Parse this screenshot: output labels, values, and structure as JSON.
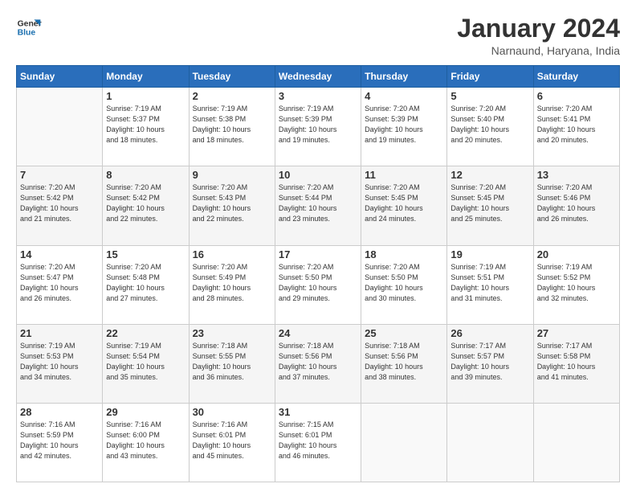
{
  "header": {
    "logo_line1": "General",
    "logo_line2": "Blue",
    "title": "January 2024",
    "location": "Narnaund, Haryana, India"
  },
  "weekdays": [
    "Sunday",
    "Monday",
    "Tuesday",
    "Wednesday",
    "Thursday",
    "Friday",
    "Saturday"
  ],
  "weeks": [
    [
      {
        "day": "",
        "info": ""
      },
      {
        "day": "1",
        "info": "Sunrise: 7:19 AM\nSunset: 5:37 PM\nDaylight: 10 hours\nand 18 minutes."
      },
      {
        "day": "2",
        "info": "Sunrise: 7:19 AM\nSunset: 5:38 PM\nDaylight: 10 hours\nand 18 minutes."
      },
      {
        "day": "3",
        "info": "Sunrise: 7:19 AM\nSunset: 5:39 PM\nDaylight: 10 hours\nand 19 minutes."
      },
      {
        "day": "4",
        "info": "Sunrise: 7:20 AM\nSunset: 5:39 PM\nDaylight: 10 hours\nand 19 minutes."
      },
      {
        "day": "5",
        "info": "Sunrise: 7:20 AM\nSunset: 5:40 PM\nDaylight: 10 hours\nand 20 minutes."
      },
      {
        "day": "6",
        "info": "Sunrise: 7:20 AM\nSunset: 5:41 PM\nDaylight: 10 hours\nand 20 minutes."
      }
    ],
    [
      {
        "day": "7",
        "info": "Sunrise: 7:20 AM\nSunset: 5:42 PM\nDaylight: 10 hours\nand 21 minutes."
      },
      {
        "day": "8",
        "info": "Sunrise: 7:20 AM\nSunset: 5:42 PM\nDaylight: 10 hours\nand 22 minutes."
      },
      {
        "day": "9",
        "info": "Sunrise: 7:20 AM\nSunset: 5:43 PM\nDaylight: 10 hours\nand 22 minutes."
      },
      {
        "day": "10",
        "info": "Sunrise: 7:20 AM\nSunset: 5:44 PM\nDaylight: 10 hours\nand 23 minutes."
      },
      {
        "day": "11",
        "info": "Sunrise: 7:20 AM\nSunset: 5:45 PM\nDaylight: 10 hours\nand 24 minutes."
      },
      {
        "day": "12",
        "info": "Sunrise: 7:20 AM\nSunset: 5:45 PM\nDaylight: 10 hours\nand 25 minutes."
      },
      {
        "day": "13",
        "info": "Sunrise: 7:20 AM\nSunset: 5:46 PM\nDaylight: 10 hours\nand 26 minutes."
      }
    ],
    [
      {
        "day": "14",
        "info": "Sunrise: 7:20 AM\nSunset: 5:47 PM\nDaylight: 10 hours\nand 26 minutes."
      },
      {
        "day": "15",
        "info": "Sunrise: 7:20 AM\nSunset: 5:48 PM\nDaylight: 10 hours\nand 27 minutes."
      },
      {
        "day": "16",
        "info": "Sunrise: 7:20 AM\nSunset: 5:49 PM\nDaylight: 10 hours\nand 28 minutes."
      },
      {
        "day": "17",
        "info": "Sunrise: 7:20 AM\nSunset: 5:50 PM\nDaylight: 10 hours\nand 29 minutes."
      },
      {
        "day": "18",
        "info": "Sunrise: 7:20 AM\nSunset: 5:50 PM\nDaylight: 10 hours\nand 30 minutes."
      },
      {
        "day": "19",
        "info": "Sunrise: 7:19 AM\nSunset: 5:51 PM\nDaylight: 10 hours\nand 31 minutes."
      },
      {
        "day": "20",
        "info": "Sunrise: 7:19 AM\nSunset: 5:52 PM\nDaylight: 10 hours\nand 32 minutes."
      }
    ],
    [
      {
        "day": "21",
        "info": "Sunrise: 7:19 AM\nSunset: 5:53 PM\nDaylight: 10 hours\nand 34 minutes."
      },
      {
        "day": "22",
        "info": "Sunrise: 7:19 AM\nSunset: 5:54 PM\nDaylight: 10 hours\nand 35 minutes."
      },
      {
        "day": "23",
        "info": "Sunrise: 7:18 AM\nSunset: 5:55 PM\nDaylight: 10 hours\nand 36 minutes."
      },
      {
        "day": "24",
        "info": "Sunrise: 7:18 AM\nSunset: 5:56 PM\nDaylight: 10 hours\nand 37 minutes."
      },
      {
        "day": "25",
        "info": "Sunrise: 7:18 AM\nSunset: 5:56 PM\nDaylight: 10 hours\nand 38 minutes."
      },
      {
        "day": "26",
        "info": "Sunrise: 7:17 AM\nSunset: 5:57 PM\nDaylight: 10 hours\nand 39 minutes."
      },
      {
        "day": "27",
        "info": "Sunrise: 7:17 AM\nSunset: 5:58 PM\nDaylight: 10 hours\nand 41 minutes."
      }
    ],
    [
      {
        "day": "28",
        "info": "Sunrise: 7:16 AM\nSunset: 5:59 PM\nDaylight: 10 hours\nand 42 minutes."
      },
      {
        "day": "29",
        "info": "Sunrise: 7:16 AM\nSunset: 6:00 PM\nDaylight: 10 hours\nand 43 minutes."
      },
      {
        "day": "30",
        "info": "Sunrise: 7:16 AM\nSunset: 6:01 PM\nDaylight: 10 hours\nand 45 minutes."
      },
      {
        "day": "31",
        "info": "Sunrise: 7:15 AM\nSunset: 6:01 PM\nDaylight: 10 hours\nand 46 minutes."
      },
      {
        "day": "",
        "info": ""
      },
      {
        "day": "",
        "info": ""
      },
      {
        "day": "",
        "info": ""
      }
    ]
  ]
}
